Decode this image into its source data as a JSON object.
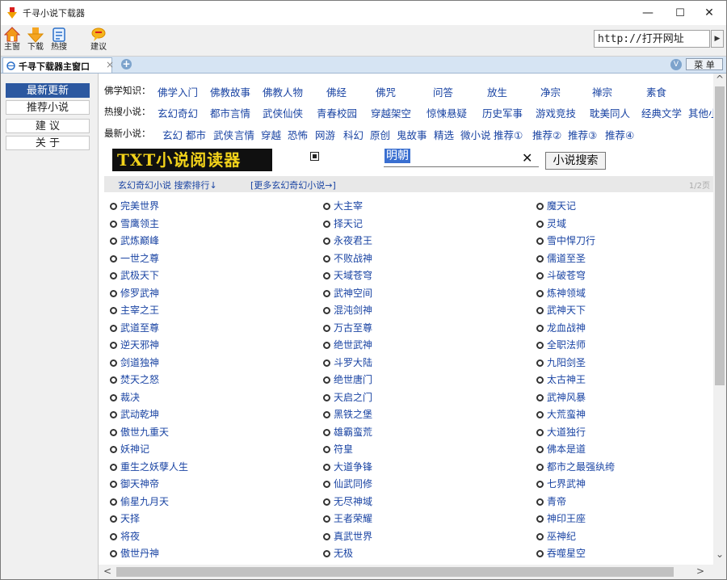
{
  "window": {
    "title": "千寻小说下载器",
    "controls": {
      "minimize": "—",
      "maximize": "☐",
      "close": "✕"
    }
  },
  "toolbar": {
    "buttons": [
      {
        "label": "主窗",
        "icon": "home-icon"
      },
      {
        "label": "下载",
        "icon": "download-arrow-icon"
      },
      {
        "label": "热搜",
        "icon": "document-icon"
      },
      {
        "label": "建议",
        "icon": "speech-bubble-icon"
      }
    ],
    "address": "http://打开网址",
    "go_arrow": "▶"
  },
  "tabs": {
    "active_label": "千寻下载器主窗口",
    "close": "×",
    "new": "+",
    "v_button": "V",
    "menu": "菜 单"
  },
  "sidebar": {
    "items": [
      "最新更新",
      "推荐小说",
      "建 议",
      "关 于"
    ],
    "active_index": 0
  },
  "nav": {
    "row1": {
      "label": "佛学知识：",
      "links": [
        "佛学入门",
        "佛教故事",
        "佛教人物",
        "佛经",
        "佛咒",
        "问答",
        "放生",
        "净宗",
        "禅宗",
        "素食"
      ]
    },
    "row2": {
      "label": "热搜小说：",
      "links": [
        "玄幻奇幻",
        "都市言情",
        "武侠仙侠",
        "青春校园",
        "穿越架空",
        "惊悚悬疑",
        "历史军事",
        "游戏竞技",
        "耽美同人",
        "经典文学",
        "其他小"
      ]
    },
    "row3": {
      "label": "最新小说：",
      "links": [
        "玄幻",
        "都市",
        "武侠",
        "言情",
        "穿越",
        "恐怖",
        "网游",
        "科幻",
        "原创",
        "鬼故事",
        "精选",
        "微小说",
        "推荐①",
        "推荐②",
        "推荐③",
        "推荐④"
      ]
    }
  },
  "search": {
    "banner": "TXT小说阅读器",
    "value": "明朝",
    "clear": "✕",
    "button": "小说搜索"
  },
  "section": {
    "title": "玄幻奇幻小说 搜索排行↓",
    "more": "[更多玄幻奇幻小说→]",
    "page": "1/2页"
  },
  "novels": [
    [
      "完美世界",
      "大主宰",
      "魔天记"
    ],
    [
      "雪鹰领主",
      "择天记",
      "灵域"
    ],
    [
      "武炼巅峰",
      "永夜君王",
      "雪中悍刀行"
    ],
    [
      "一世之尊",
      "不败战神",
      "儒道至圣"
    ],
    [
      "武极天下",
      "天域苍穹",
      "斗破苍穹"
    ],
    [
      "修罗武神",
      "武神空间",
      "炼神领域"
    ],
    [
      "主宰之王",
      "混沌剑神",
      "武神天下"
    ],
    [
      "武道至尊",
      "万古至尊",
      "龙血战神"
    ],
    [
      "逆天邪神",
      "绝世武神",
      "全职法师"
    ],
    [
      "剑道独神",
      "斗罗大陆",
      "九阳剑圣"
    ],
    [
      "焚天之怒",
      "绝世唐门",
      "太古神王"
    ],
    [
      "裁决",
      "天启之门",
      "武神风暴"
    ],
    [
      "武动乾坤",
      "黑铁之堡",
      "大荒蛮神"
    ],
    [
      "傲世九重天",
      "雄霸蛮荒",
      "大道独行"
    ],
    [
      "妖神记",
      "符皇",
      "佛本是道"
    ],
    [
      "重生之妖孽人生",
      "大道争锋",
      "都市之最强纨绔"
    ],
    [
      "御天神帝",
      "仙武同修",
      "七界武神"
    ],
    [
      "偷星九月天",
      "无尽神域",
      "青帝"
    ],
    [
      "天择",
      "王者荣耀",
      "神印王座"
    ],
    [
      "将夜",
      "真武世界",
      "巫神纪"
    ],
    [
      "傲世丹神",
      "无极",
      "吞噬星空"
    ]
  ]
}
